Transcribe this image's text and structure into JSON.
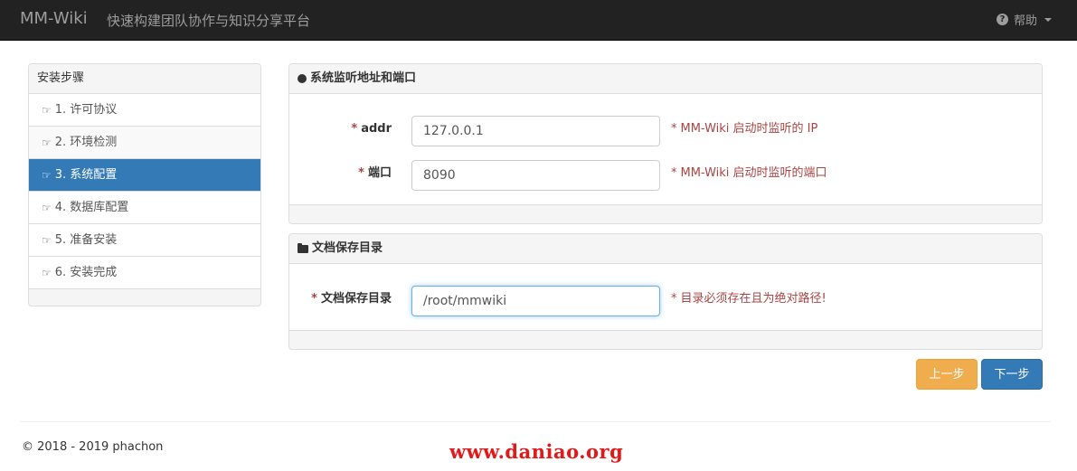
{
  "navbar": {
    "brand": "MM-Wiki",
    "tagline": "快速构建团队协作与知识分享平台",
    "help_label": "帮助"
  },
  "sidebar": {
    "title": "安装步骤",
    "items": [
      {
        "label": "1. 许可协议"
      },
      {
        "label": "2. 环境检测"
      },
      {
        "label": "3. 系统配置"
      },
      {
        "label": "4. 数据库配置"
      },
      {
        "label": "5. 准备安装"
      },
      {
        "label": "6. 安装完成"
      }
    ],
    "active_index": 2
  },
  "panel_listen": {
    "title": "系统监听地址和端口",
    "addr": {
      "label": "addr",
      "value": "127.0.0.1",
      "hint": "MM-Wiki 启动时监听的 IP"
    },
    "port": {
      "label": "端口",
      "value": "8090",
      "hint": "MM-Wiki 启动时监听的端口"
    }
  },
  "panel_dir": {
    "title": "文档保存目录",
    "dir": {
      "label": "文档保存目录",
      "value": "/root/mmwiki",
      "hint": "目录必须存在且为绝对路径!"
    }
  },
  "buttons": {
    "prev": "上一步",
    "next": "下一步"
  },
  "footer": {
    "copyright": "© 2018 - 2019 phachon"
  },
  "watermark": "www.daniao.org",
  "colors": {
    "primary": "#337ab7",
    "warning": "#f0ad4e",
    "danger": "#a94442",
    "navbar": "#222222"
  }
}
